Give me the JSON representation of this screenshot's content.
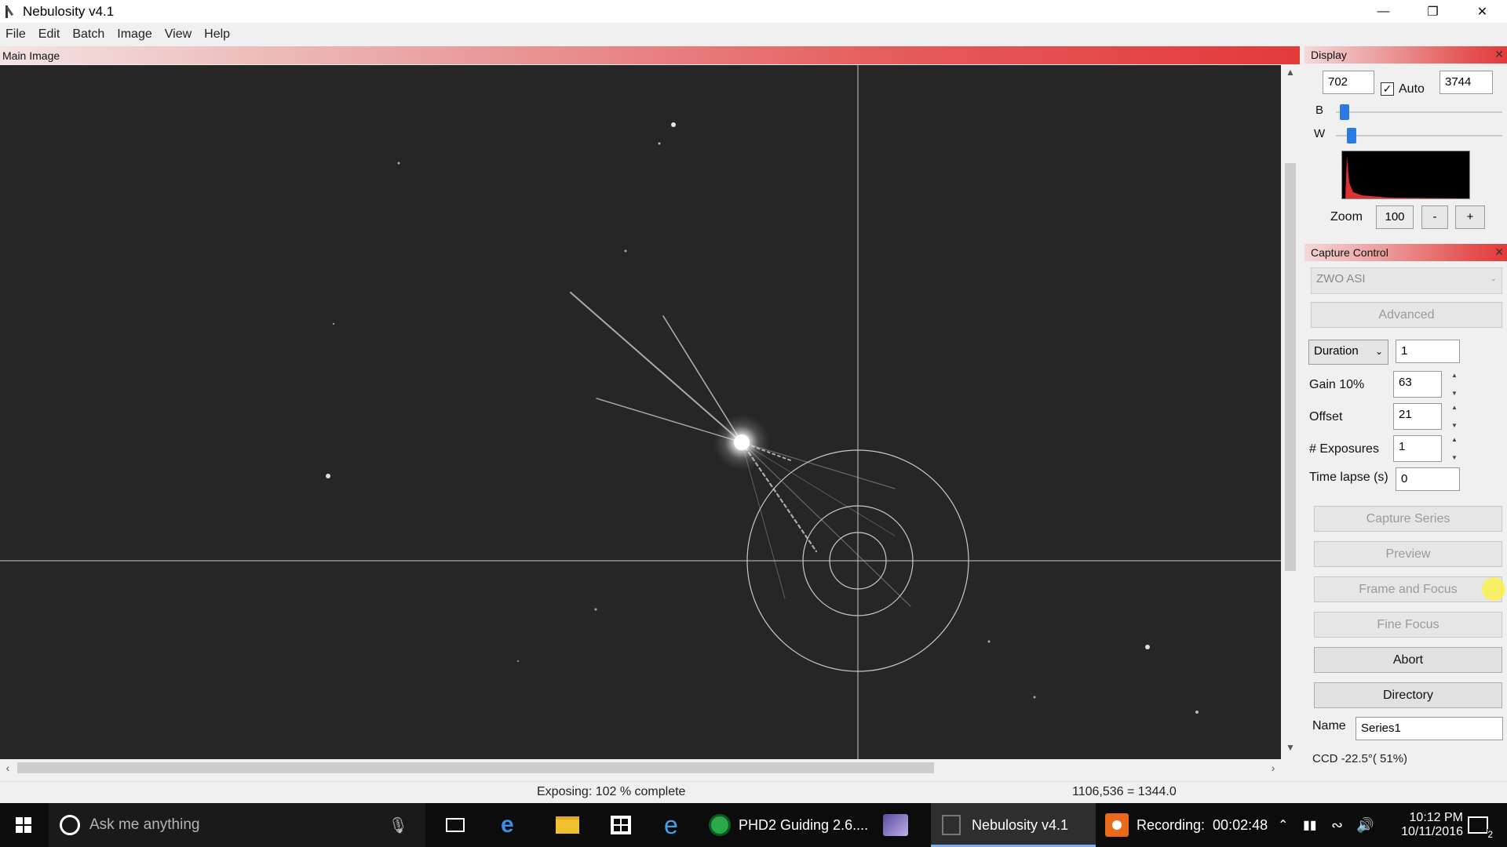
{
  "window": {
    "title": "Nebulosity v4.1",
    "minimize": "—",
    "restore": "❐",
    "close": "✕"
  },
  "menu": [
    "File",
    "Edit",
    "Batch",
    "Image",
    "View",
    "Help"
  ],
  "main_image": {
    "title": "Main Image"
  },
  "status": {
    "progress": "Exposing: 102 % complete",
    "progress_percent": 102,
    "pixel_info": "1106,536 = 1344.0"
  },
  "display_panel": {
    "title": "Display",
    "black_value": "702",
    "auto_label": "Auto",
    "auto_checked": true,
    "white_value": "3744",
    "b_label": "B",
    "w_label": "W",
    "zoom_label": "Zoom",
    "zoom_value": "100",
    "zoom_minus": "-",
    "zoom_plus": "+"
  },
  "capture_panel": {
    "title": "Capture Control",
    "camera": "ZWO ASI",
    "advanced": "Advanced",
    "duration_mode": "Duration",
    "duration_value": "1",
    "gain_label": "Gain 10%",
    "gain_value": "63",
    "offset_label": "Offset",
    "offset_value": "21",
    "exposures_label": "# Exposures",
    "exposures_value": "1",
    "timelapse_label": "Time lapse (s)",
    "timelapse_value": "0",
    "buttons": {
      "capture_series": "Capture Series",
      "preview": "Preview",
      "frame_focus": "Frame and Focus",
      "fine_focus": "Fine Focus",
      "abort": "Abort",
      "directory": "Directory"
    },
    "name_label": "Name",
    "name_value": "Series1",
    "ccd_status": "CCD -22.5°( 51%)"
  },
  "taskbar": {
    "search_placeholder": "Ask me anything",
    "phd2": "PHD2 Guiding 2.6....",
    "nebulosity": "Nebulosity v4.1",
    "recording": "Recording:  00:02:48",
    "time": "10:12 PM",
    "date": "10/11/2016",
    "notification_count": "2"
  },
  "colors": {
    "accent_header": "#e33a3a",
    "slider": "#2a7ae0",
    "canvas_bg": "#262626"
  }
}
